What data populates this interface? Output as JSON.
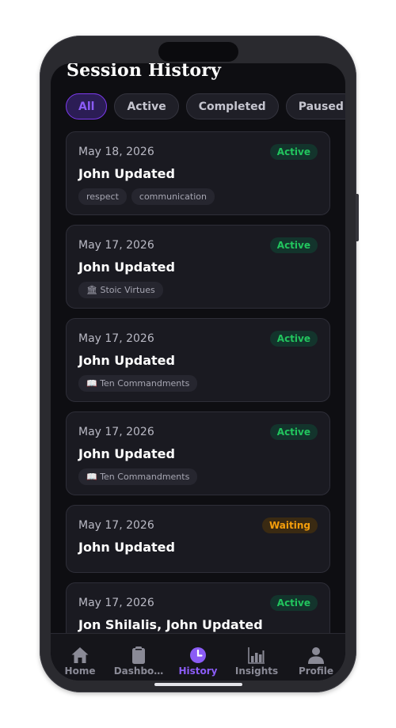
{
  "page": {
    "title": "Session History"
  },
  "filters": [
    {
      "label": "All",
      "selected": true
    },
    {
      "label": "Active",
      "selected": false
    },
    {
      "label": "Completed",
      "selected": false
    },
    {
      "label": "Paused",
      "selected": false
    }
  ],
  "sessions": [
    {
      "date": "May 18, 2026",
      "status": "Active",
      "name": "John Updated",
      "tags": [
        "respect",
        "communication"
      ]
    },
    {
      "date": "May 17, 2026",
      "status": "Active",
      "name": "John Updated",
      "tags": [
        "🏛 Stoic Virtues"
      ]
    },
    {
      "date": "May 17, 2026",
      "status": "Active",
      "name": "John Updated",
      "tags": [
        "📖 Ten Commandments"
      ]
    },
    {
      "date": "May 17, 2026",
      "status": "Active",
      "name": "John Updated",
      "tags": [
        "📖 Ten Commandments"
      ]
    },
    {
      "date": "May 17, 2026",
      "status": "Waiting",
      "name": "John Updated",
      "tags": []
    },
    {
      "date": "May 17, 2026",
      "status": "Active",
      "name": "Jon Shilalis, John Updated",
      "tags": []
    }
  ],
  "nav": {
    "home": {
      "label": "Home",
      "icon": "house-icon"
    },
    "dashboard": {
      "label": "Dashbo…",
      "icon": "clipboard-icon"
    },
    "history": {
      "label": "History",
      "icon": "clock-icon"
    },
    "insights": {
      "label": "Insights",
      "icon": "bar-chart-icon"
    },
    "profile": {
      "label": "Profile",
      "icon": "person-icon"
    }
  },
  "colors": {
    "accent": "#8b5cf6",
    "active_status": "#22c55e",
    "waiting_status": "#f59e0b",
    "background": "#0e0e12",
    "card": "#1a1a21"
  }
}
